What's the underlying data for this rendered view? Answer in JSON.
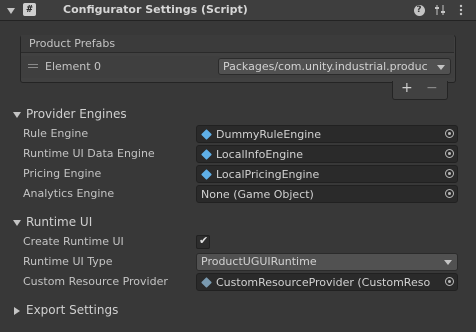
{
  "header": {
    "title": "Configurator Settings (Script)",
    "script_icon_glyph": "#",
    "icons": [
      "help-icon",
      "presets-icon",
      "more-menu-icon"
    ]
  },
  "product_prefabs": {
    "title": "Product Prefabs",
    "elements": [
      {
        "label": "Element 0",
        "value": "Packages/com.unity.industrial.produc"
      }
    ],
    "add_label": "+",
    "remove_label": "−"
  },
  "provider_engines": {
    "title": "Provider Engines",
    "rows": [
      {
        "label": "Rule Engine",
        "value": "DummyRuleEngine",
        "icon": "script-asset-icon"
      },
      {
        "label": "Runtime UI Data Engine",
        "value": "LocalInfoEngine",
        "icon": "script-asset-icon"
      },
      {
        "label": "Pricing Engine",
        "value": "LocalPricingEngine",
        "icon": "script-asset-icon"
      },
      {
        "label": "Analytics Engine",
        "value": "None (Game Object)",
        "icon": ""
      }
    ]
  },
  "runtime_ui": {
    "title": "Runtime UI",
    "create_label": "Create Runtime UI",
    "create_checked": true,
    "type_label": "Runtime UI Type",
    "type_value": "ProductUGUIRuntime",
    "custom_label": "Custom Resource Provider",
    "custom_value": "CustomResourceProvider (CustomReso"
  },
  "export_settings": {
    "title": "Export Settings"
  },
  "colors": {
    "background": "#383838",
    "field": "#2a2a2a",
    "icon_blue": "#5fb0e8"
  }
}
